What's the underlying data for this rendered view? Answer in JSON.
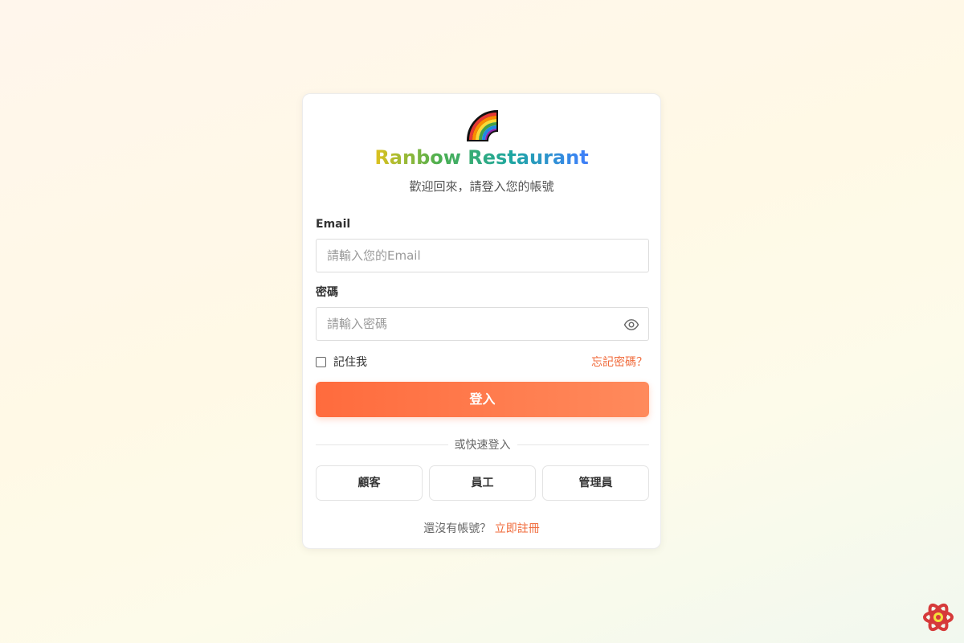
{
  "brand": {
    "name": "Ranbow Restaurant",
    "subtitle": "歡迎回來，請登入您的帳號",
    "logo_icon": "rainbow-icon"
  },
  "form": {
    "email_label": "Email",
    "email_placeholder": "請輸入您的Email",
    "email_value": "",
    "password_label": "密碼",
    "password_placeholder": "請輸入密碼",
    "password_value": "",
    "password_toggle_icon": "eye-icon",
    "remember_label": "記住我",
    "remember_checked": false,
    "forgot_label": "忘記密碼？",
    "submit_label": "登入"
  },
  "quick_login": {
    "divider_label": "或快速登入",
    "options": [
      "顧客",
      "員工",
      "管理員"
    ]
  },
  "signup": {
    "prompt": "還沒有帳號？",
    "link_label": "立即註冊"
  },
  "corner_badge": {
    "icon": "react-devtools-icon"
  },
  "colors": {
    "accent": "#f06a3a",
    "button_start": "#ff6b3d",
    "button_end": "#ff8a5c"
  }
}
